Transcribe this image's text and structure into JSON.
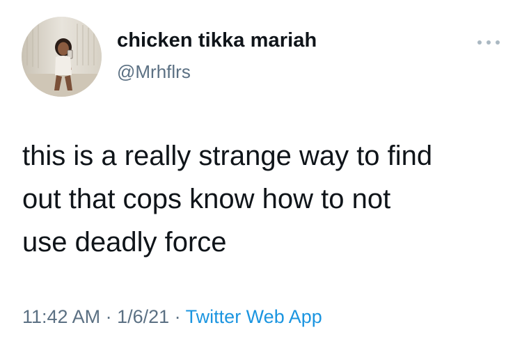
{
  "tweet": {
    "display_name": "chicken tikka mariah",
    "handle": "@Mrhflrs",
    "text_line_1": "this is a really strange way to find",
    "text_line_2": "out that cops know how to not",
    "text_line_3": "use deadly force",
    "time": "11:42 AM",
    "separator": " · ",
    "date": "1/6/21",
    "source": "Twitter Web App"
  },
  "icons": {
    "more": "more-options-icon",
    "avatar": "profile-photo"
  },
  "colors": {
    "text": "#0f1419",
    "secondary": "#5b7083",
    "link": "#1b95e0",
    "background": "#ffffff"
  }
}
